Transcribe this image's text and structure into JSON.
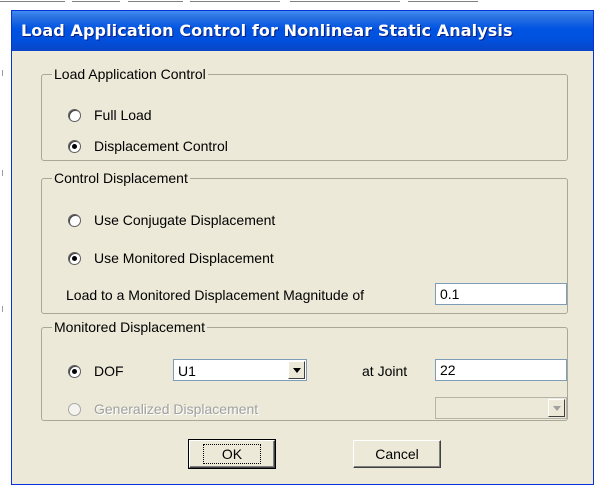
{
  "dialog": {
    "title": "Load Application Control for Nonlinear Static Analysis"
  },
  "load_application_control": {
    "legend": "Load Application Control",
    "options": [
      {
        "label": "Full Load",
        "checked": false
      },
      {
        "label": "Displacement Control",
        "checked": true
      }
    ]
  },
  "control_displacement": {
    "legend": "Control Displacement",
    "options": [
      {
        "label": "Use Conjugate Displacement",
        "checked": false
      },
      {
        "label": "Use Monitored Displacement",
        "checked": true
      }
    ],
    "magnitude_label": "Load to a Monitored Displacement Magnitude of",
    "magnitude_value": "0.1"
  },
  "monitored_displacement": {
    "legend": "Monitored Displacement",
    "dof_label": "DOF",
    "dof_value": "U1",
    "joint_label": "at Joint",
    "joint_value": "22",
    "generalized_label": "Generalized Displacement",
    "generalized_value": ""
  },
  "buttons": {
    "ok": "OK",
    "cancel": "Cancel"
  }
}
